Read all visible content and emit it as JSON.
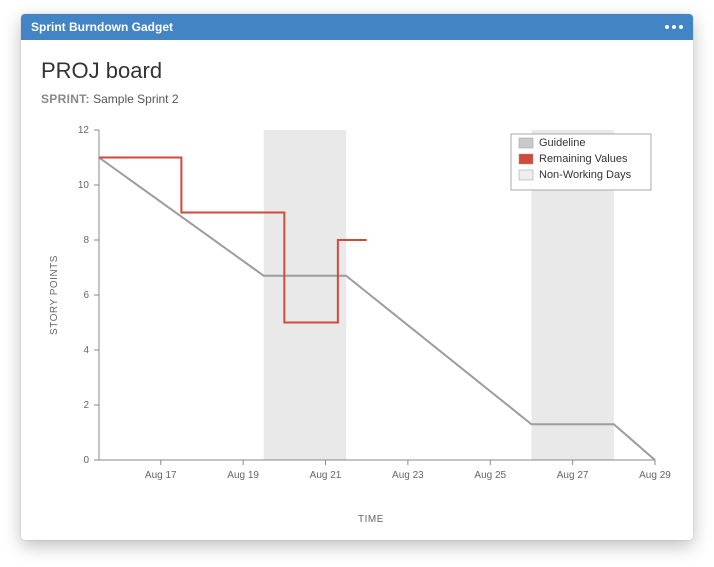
{
  "gadget": {
    "title": "Sprint Burndown Gadget"
  },
  "board": {
    "title": "PROJ board",
    "sprint_label": "SPRINT:",
    "sprint_name": "Sample Sprint 2"
  },
  "legend": {
    "guideline": "Guideline",
    "remaining": "Remaining Values",
    "nonworking": "Non-Working Days"
  },
  "axes": {
    "xlabel": "TIME",
    "ylabel": "STORY POINTS"
  },
  "chart_data": {
    "type": "line",
    "xlabel": "TIME",
    "ylabel": "STORY POINTS",
    "title": "Sprint Burndown Gadget",
    "ylim": [
      0,
      12
    ],
    "y_ticks": [
      0,
      2,
      4,
      6,
      8,
      10,
      12
    ],
    "x_categories": [
      "Aug 17",
      "Aug 19",
      "Aug 21",
      "Aug 23",
      "Aug 25",
      "Aug 27",
      "Aug 29"
    ],
    "non_working_bands": [
      {
        "start": "Aug 19.5",
        "end": "Aug 21.5"
      },
      {
        "start": "Aug 26",
        "end": "Aug 28"
      }
    ],
    "series": [
      {
        "name": "Guideline",
        "color": "#9d9d9d",
        "points": [
          {
            "x": "Aug 15.5",
            "y": 11.0
          },
          {
            "x": "Aug 19.5",
            "y": 6.7
          },
          {
            "x": "Aug 21.5",
            "y": 6.7
          },
          {
            "x": "Aug 26",
            "y": 1.3
          },
          {
            "x": "Aug 28",
            "y": 1.3
          },
          {
            "x": "Aug 29",
            "y": 0.0
          }
        ]
      },
      {
        "name": "Remaining Values",
        "color": "#d24a3a",
        "points": [
          {
            "x": "Aug 15.5",
            "y": 11
          },
          {
            "x": "Aug 17.5",
            "y": 11
          },
          {
            "x": "Aug 17.5",
            "y": 9
          },
          {
            "x": "Aug 20",
            "y": 9
          },
          {
            "x": "Aug 20",
            "y": 5
          },
          {
            "x": "Aug 21.3",
            "y": 5
          },
          {
            "x": "Aug 21.3",
            "y": 8
          },
          {
            "x": "Aug 22",
            "y": 8
          }
        ]
      }
    ]
  }
}
